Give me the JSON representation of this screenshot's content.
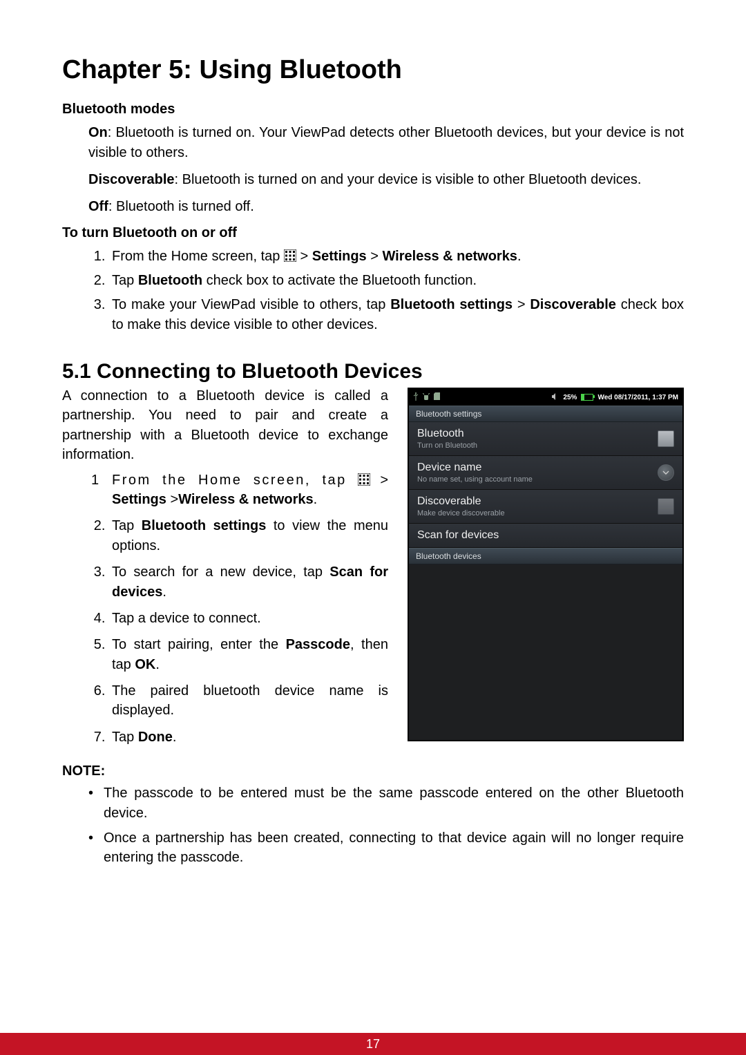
{
  "page_number": "17",
  "chapter_title": "Chapter 5: Using Bluetooth",
  "section_modes_heading": "Bluetooth modes",
  "modes": {
    "on_label": "On",
    "on_text": ": Bluetooth is turned on. Your ViewPad detects other Bluetooth devices, but your device is not visible to others.",
    "discoverable_label": "Discoverable",
    "discoverable_text": ": Bluetooth is turned on and your device is visible to other Bluetooth devices.",
    "off_label": "Off",
    "off_text": ": Bluetooth is turned off."
  },
  "section_toggle_heading": "To turn Bluetooth on or off",
  "toggle_steps": {
    "s1_pre": "From the Home screen, tap ",
    "s1_sep1": " > ",
    "s1_b1": "Settings",
    "s1_sep2": " > ",
    "s1_b2": "Wireless & networks",
    "s1_end": ".",
    "s2_pre": "Tap ",
    "s2_b": "Bluetooth",
    "s2_post": " check box to activate the Bluetooth function.",
    "s3_pre": "To make your ViewPad visible to others, tap ",
    "s3_b1": "Bluetooth settings",
    "s3_sep": " > ",
    "s3_b2": "Discoverable",
    "s3_post": " check box to make this device visible to other devices."
  },
  "h2_title": "5.1 Connecting to Bluetooth Devices",
  "connect_intro": "A connection to a Bluetooth device is called a partnership. You need to pair and create a partnership with a Bluetooth device to exchange information.",
  "connect_steps": {
    "s1_pre": "From the Home screen, tap ",
    "s1_sep": " > ",
    "s1_b1": "Settings",
    "s1_sep2": " >",
    "s1_b2": "Wireless & networks",
    "s1_end": ".",
    "s2_pre": "Tap ",
    "s2_b": "Bluetooth settings",
    "s2_post": " to view the menu options.",
    "s3_pre": "To search for a new device, tap ",
    "s3_b": "Scan for devices",
    "s3_end": ".",
    "s4": "Tap a device to connect.",
    "s5_pre": "To start pairing, enter the ",
    "s5_b1": "Passcode",
    "s5_mid": ", then tap ",
    "s5_b2": "OK",
    "s5_end": ".",
    "s6": "The paired bluetooth device name is displayed.",
    "s7_pre": "Tap ",
    "s7_b": "Done",
    "s7_end": "."
  },
  "note_label": "NOTE",
  "note_colon": ":",
  "notes": {
    "n1": "The passcode to be entered must be the same passcode entered on the other Bluetooth device.",
    "n2": "Once a partnership has been created, connecting to that device again will no longer require entering the passcode."
  },
  "bt_screen": {
    "status": {
      "battery_pct": "25%",
      "datetime": "Wed 08/17/2011, 1:37 PM"
    },
    "header1": "Bluetooth settings",
    "row_bluetooth": {
      "title": "Bluetooth",
      "sub": "Turn on Bluetooth"
    },
    "row_devname": {
      "title": "Device name",
      "sub": "No name set, using account name"
    },
    "row_discover": {
      "title": "Discoverable",
      "sub": "Make device discoverable"
    },
    "row_scan": {
      "title": "Scan for devices"
    },
    "header2": "Bluetooth devices"
  }
}
